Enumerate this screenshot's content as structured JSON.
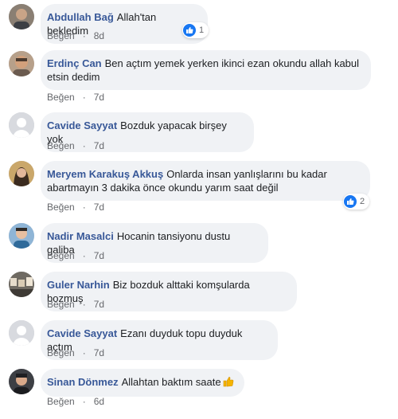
{
  "colors": {
    "author": "#385898",
    "bubble": "#f0f2f5",
    "meta": "#65676b",
    "like_blue": "#1877f2"
  },
  "comments": [
    {
      "author": "Abdullah Bağ",
      "text": "Allah'tan bekledim",
      "like_label": "Beğen",
      "separator": "·",
      "time": "8d",
      "reaction_icon": "like-icon",
      "reaction_count": "1"
    },
    {
      "author": "Erdinç Can",
      "text": "Ben açtım yemek yerken ikinci ezan okundu allah kabul etsin dedim",
      "like_label": "Beğen",
      "separator": "·",
      "time": "7d"
    },
    {
      "author": "Cavide Sayyat",
      "text": "Bozduk yapacak birşey yok",
      "like_label": "Beğen",
      "separator": "·",
      "time": "7d"
    },
    {
      "author": "Meryem Karakuş Akkuş",
      "text": "Onlarda insan yanlışlarını bu kadar abartmayın 3 dakika önce okundu yarım saat değil",
      "like_label": "Beğen",
      "separator": "·",
      "time": "7d",
      "reaction_icon": "like-icon",
      "reaction_count": "2"
    },
    {
      "author": "Nadir Masalci",
      "text": "Hocanin tansiyonu dustu galiba",
      "like_label": "Beğen",
      "separator": "·",
      "time": "7d"
    },
    {
      "author": "Guler Narhin",
      "text": "Biz bozduk alttaki komşularda bozmuş",
      "like_label": "Beğen",
      "separator": "·",
      "time": "7d"
    },
    {
      "author": "Cavide Sayyat",
      "text": "Ezanı duyduk topu duyduk açtım",
      "like_label": "Beğen",
      "separator": "·",
      "time": "7d"
    },
    {
      "author": "Sinan Dönmez",
      "text": "Allahtan baktım saate",
      "emoji": "thumbs-up-emoji",
      "like_label": "Beğen",
      "separator": "·",
      "time": "6d"
    }
  ]
}
